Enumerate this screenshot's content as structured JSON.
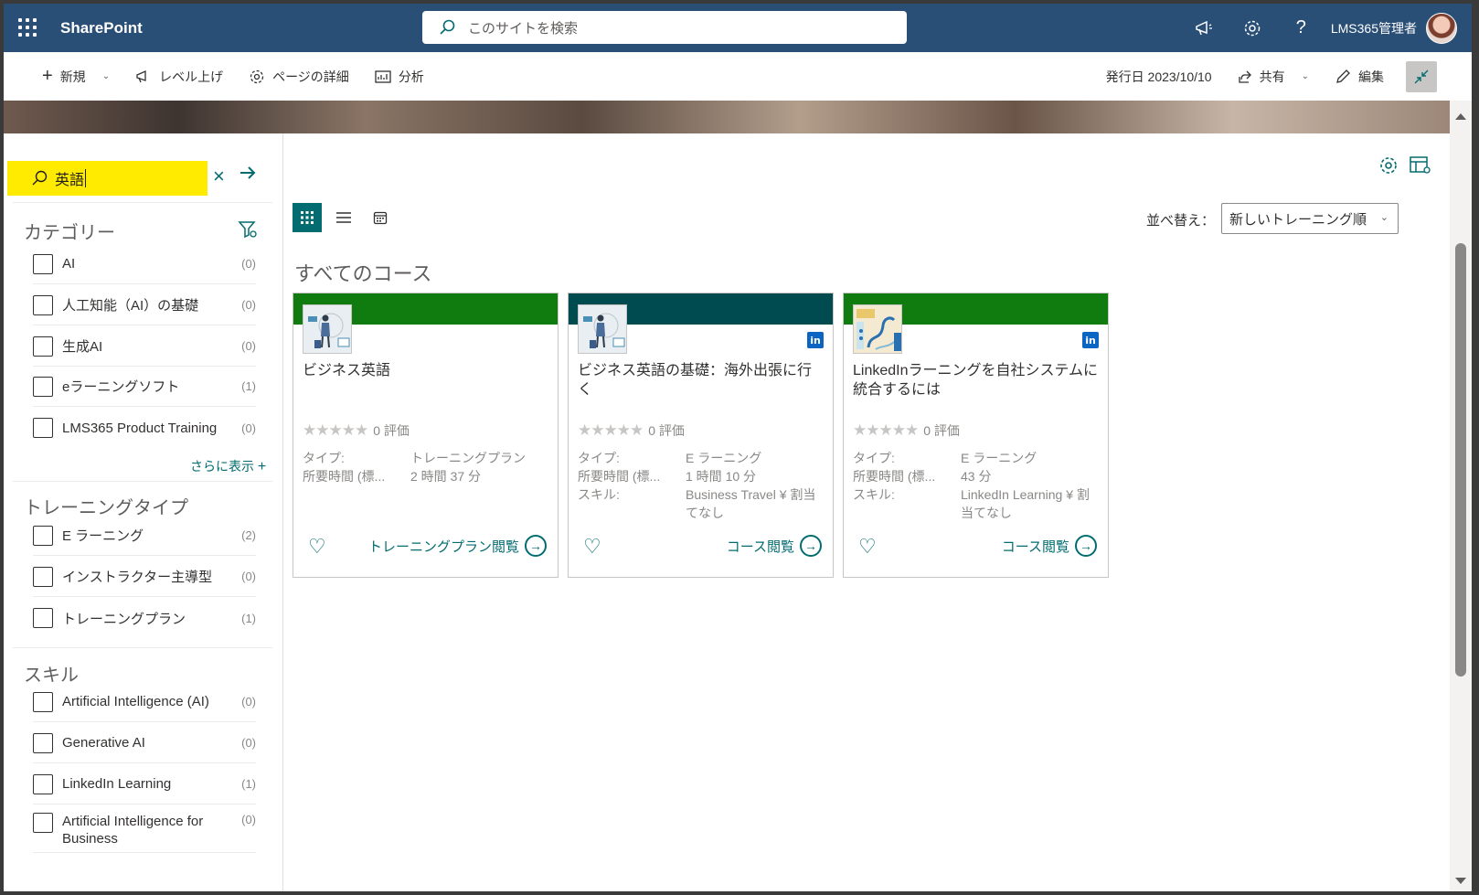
{
  "suite": {
    "app_name": "SharePoint",
    "search_placeholder": "このサイトを検索",
    "user_name": "LMS365管理者"
  },
  "commandbar": {
    "new_label": "新規",
    "promote_label": "レベル上げ",
    "page_details_label": "ページの詳細",
    "analytics_label": "分析",
    "published": "発行日 2023/10/10",
    "share_label": "共有",
    "edit_label": "編集"
  },
  "filter": {
    "keyword": "英語",
    "categories": {
      "title": "カテゴリー",
      "items": [
        {
          "label": "AI",
          "count": "(0)"
        },
        {
          "label": "人工知能（AI）の基礎",
          "count": "(0)"
        },
        {
          "label": "生成AI",
          "count": "(0)"
        },
        {
          "label": "eラーニングソフト",
          "count": "(1)"
        },
        {
          "label": "LMS365 Product Training",
          "count": "(0)"
        }
      ],
      "more_label": "さらに表示"
    },
    "training_type": {
      "title": "トレーニングタイプ",
      "items": [
        {
          "label": "E ラーニング",
          "count": "(2)"
        },
        {
          "label": "インストラクター主導型",
          "count": "(0)"
        },
        {
          "label": "トレーニングプラン",
          "count": "(1)"
        }
      ]
    },
    "skills": {
      "title": "スキル",
      "items": [
        {
          "label": "Artificial Intelligence (AI)",
          "count": "(0)"
        },
        {
          "label": "Generative AI",
          "count": "(0)"
        },
        {
          "label": "LinkedIn Learning",
          "count": "(1)"
        },
        {
          "label": "Artificial Intelligence for Business",
          "count": "(0)"
        }
      ]
    }
  },
  "main": {
    "sort_label": "並べ替え：",
    "sort_value": "新しいトレーニング順",
    "section_title": "すべてのコース",
    "cards": [
      {
        "title": "ビジネス英語",
        "rating": "0 評価",
        "type_key": "タイプ:",
        "type_val": "トレーニングプラン",
        "duration_key": "所要時間 (標...",
        "duration_val": "2 時間 37 分",
        "skill_key": "",
        "skill_val": "",
        "action": "トレーニングプラン閲覧",
        "band_color": "#107c10",
        "linkedin": false
      },
      {
        "title": "ビジネス英語の基礎：海外出張に行く",
        "rating": "0 評価",
        "type_key": "タイプ:",
        "type_val": "E ラーニング",
        "duration_key": "所要時間 (標...",
        "duration_val": "1 時間 10 分",
        "skill_key": "スキル:",
        "skill_val": "Business Travel ¥ 割当てなし",
        "action": "コース閲覧",
        "band_color": "#004b50",
        "linkedin": true
      },
      {
        "title": "LinkedInラーニングを自社システムに統合するには",
        "rating": "0 評価",
        "type_key": "タイプ:",
        "type_val": "E ラーニング",
        "duration_key": "所要時間 (標...",
        "duration_val": "43 分",
        "skill_key": "スキル:",
        "skill_val": "LinkedIn Learning ¥ 割当てなし",
        "action": "コース閲覧",
        "band_color": "#107c10",
        "linkedin": true
      }
    ],
    "linkedin_badge": "in"
  }
}
